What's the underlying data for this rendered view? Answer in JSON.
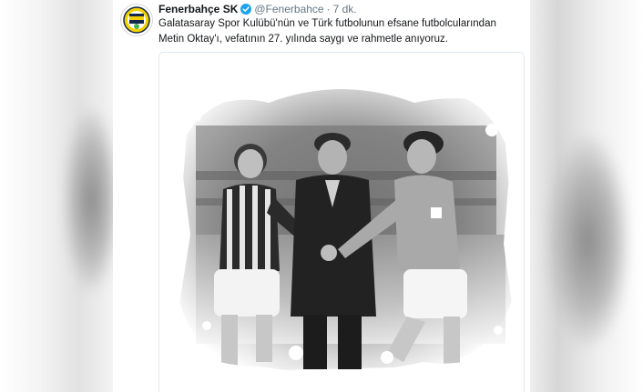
{
  "tweet": {
    "display_name": "Fenerbahçe SK",
    "handle": "@Fenerbahce",
    "separator": "·",
    "time": "7 dk.",
    "text": "Galatasaray Spor Kulübü'nün ve Türk futbolunun efsane futbolcularından Metin Oktay'ı, vefatının 27. yılında saygı ve rahmetle anıyoruz."
  },
  "icons": {
    "avatar": "fenerbahce-crest-icon",
    "verified": "verified-badge-icon"
  },
  "colors": {
    "name": "#14171a",
    "muted": "#657786",
    "verified": "#1da1f2",
    "crest_navy": "#12284c",
    "crest_yellow": "#f4d000"
  }
}
